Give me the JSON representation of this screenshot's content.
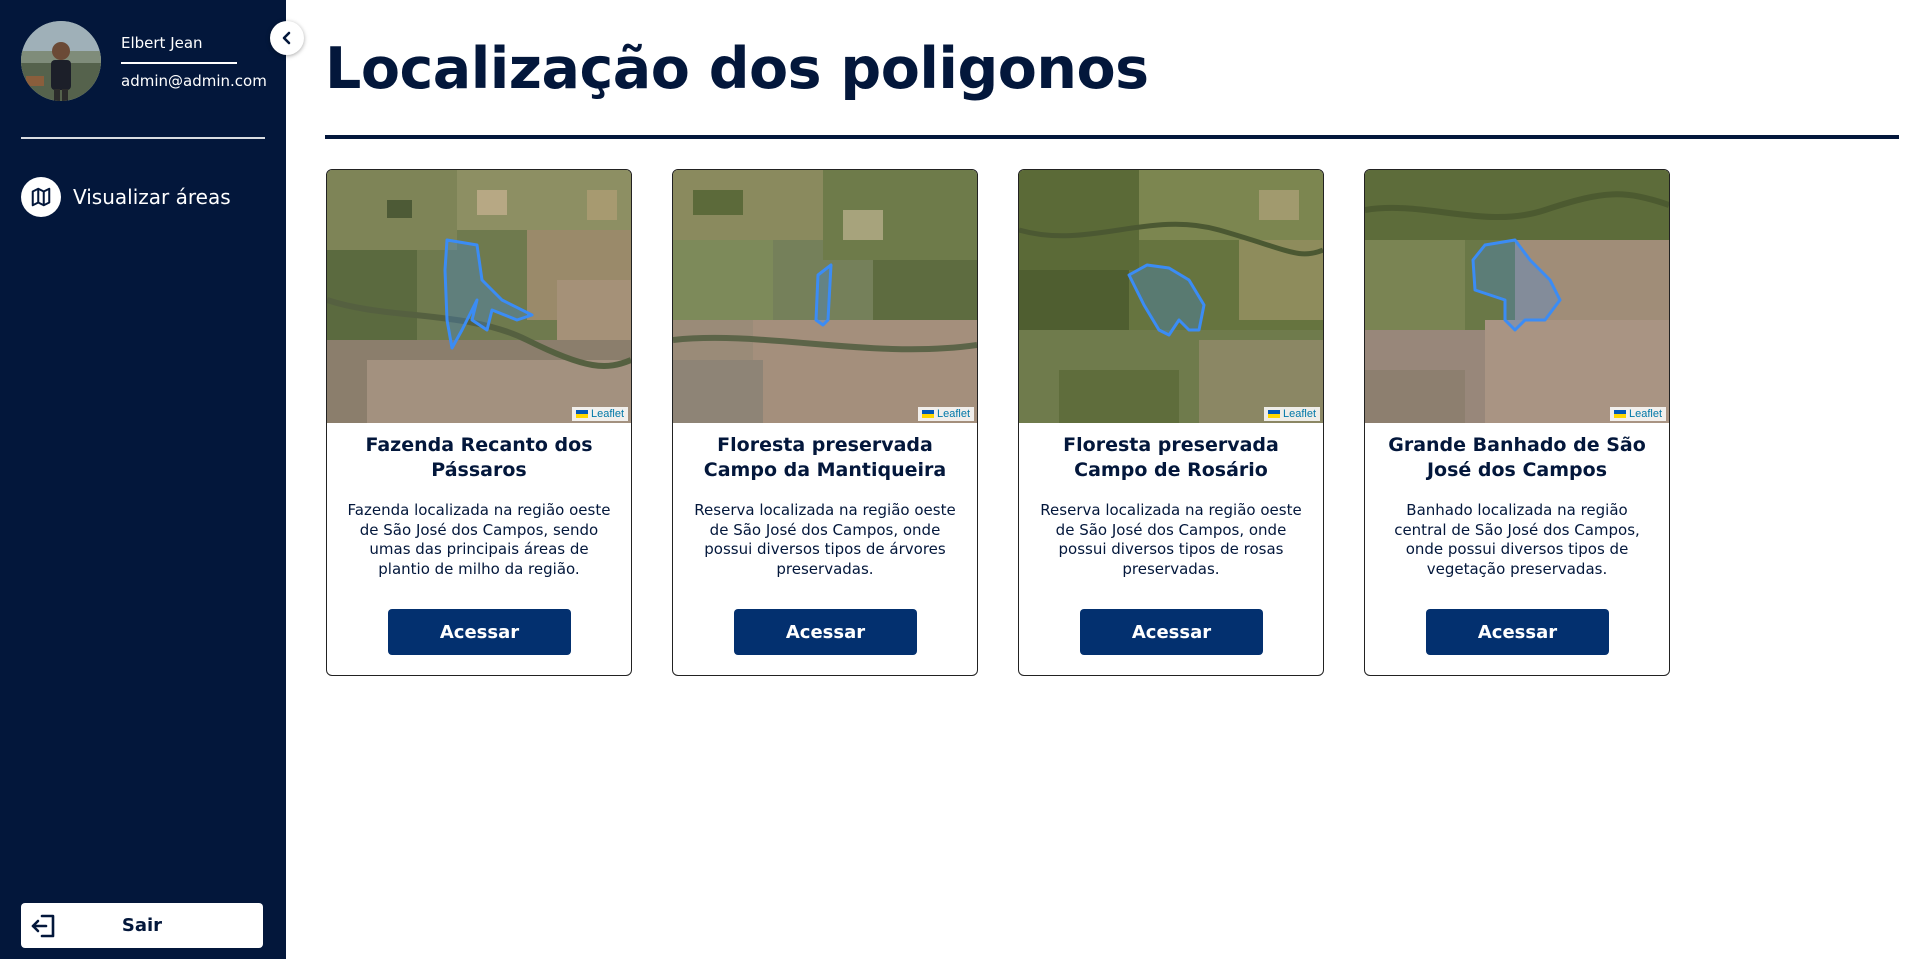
{
  "sidebar": {
    "user": {
      "name": "Elbert Jean",
      "email": "admin@admin.com"
    },
    "nav": [
      {
        "label": "Visualizar áreas",
        "icon": "map-icon"
      }
    ],
    "logout_label": "Sair"
  },
  "main": {
    "title": "Localização dos poligonos",
    "cards": [
      {
        "title": "Fazenda Recanto dos Pássaros",
        "description": "Fazenda localizada na região oeste de São José dos Campos, sendo umas das principais áreas de plantio de milho da região.",
        "button": "Acessar",
        "attribution": "Leaflet"
      },
      {
        "title": "Floresta preservada Campo da Mantiqueira",
        "description": "Reserva localizada na região oeste de São José dos Campos, onde possui diversos tipos de árvores preservadas.",
        "button": "Acessar",
        "attribution": "Leaflet"
      },
      {
        "title": "Floresta preservada Campo de Rosário",
        "description": "Reserva localizada na região oeste de São José dos Campos, onde possui diversos tipos de rosas preservadas.",
        "button": "Acessar",
        "attribution": "Leaflet"
      },
      {
        "title": "Grande Banhado de São José dos Campos",
        "description": "Banhado localizada na região central de São José dos Campos, onde possui diversos tipos de vegetação preservadas.",
        "button": "Acessar",
        "attribution": "Leaflet"
      }
    ]
  },
  "colors": {
    "sidebar_bg": "#03173b",
    "button_bg": "#03306f",
    "polygon_stroke": "#3b8cf5",
    "text_dark": "#03173b"
  }
}
